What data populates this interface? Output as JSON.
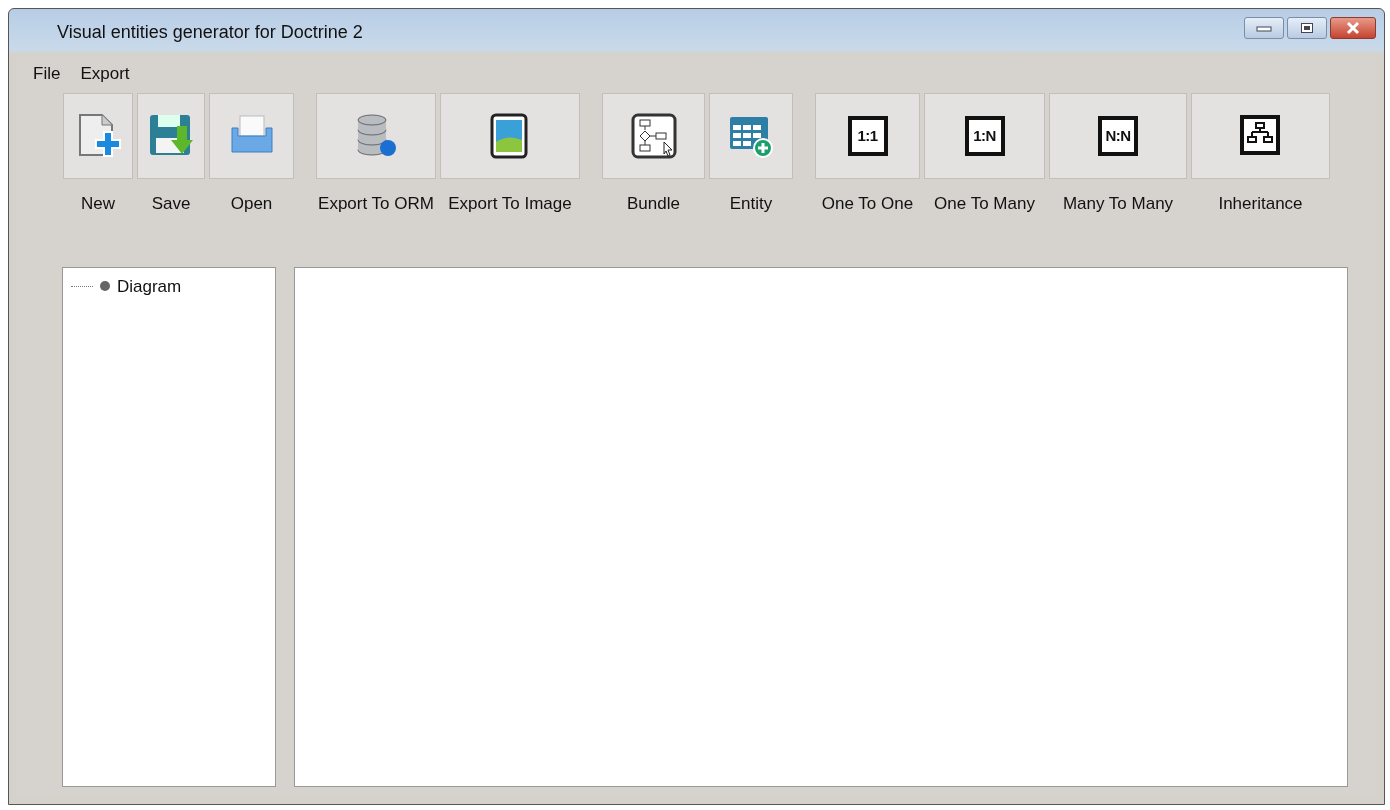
{
  "window": {
    "title": "Visual entities generator for Doctrine 2"
  },
  "menu": [
    {
      "label": "File"
    },
    {
      "label": "Export"
    }
  ],
  "toolbar_groups": [
    {
      "tools": [
        {
          "kind": "new",
          "label": "New"
        },
        {
          "kind": "save",
          "label": "Save"
        },
        {
          "kind": "open",
          "label": "Open"
        }
      ]
    },
    {
      "tools": [
        {
          "kind": "database",
          "label": "Export To ORM"
        },
        {
          "kind": "image",
          "label": "Export To Image"
        }
      ]
    },
    {
      "tools": [
        {
          "kind": "flowchart",
          "label": "Bundle"
        },
        {
          "kind": "table",
          "label": "Entity"
        }
      ]
    },
    {
      "tools": [
        {
          "kind": "relation",
          "glyph": "1:1",
          "label": "One To One"
        },
        {
          "kind": "relation",
          "glyph": "1:N",
          "label": "One To Many"
        },
        {
          "kind": "relation",
          "glyph": "N:N",
          "label": "Many To Many"
        },
        {
          "kind": "hierarchy",
          "label": "Inheritance"
        }
      ]
    }
  ],
  "tree": {
    "items": [
      {
        "label": "Diagram"
      }
    ]
  }
}
